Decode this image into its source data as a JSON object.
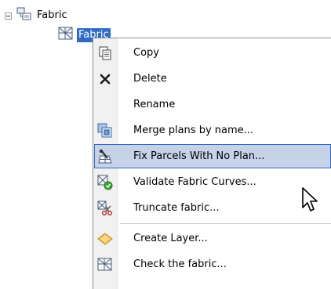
{
  "tree": {
    "root": {
      "label": "Fabric"
    },
    "child": {
      "label": "Fabric"
    }
  },
  "context_menu": {
    "items": [
      {
        "label": "Copy",
        "icon": "copy-icon"
      },
      {
        "label": "Delete",
        "icon": "delete-icon"
      },
      {
        "label": "Rename",
        "icon": ""
      },
      {
        "label": "Merge plans by name...",
        "icon": "merge-plans-icon"
      },
      {
        "label": "Fix Parcels With No Plan...",
        "icon": "fix-parcels-icon",
        "highlighted": true
      },
      {
        "label": "Validate Fabric Curves...",
        "icon": "validate-curves-icon"
      },
      {
        "label": "Truncate fabric...",
        "icon": "truncate-icon"
      },
      {
        "label": "Create Layer...",
        "icon": "create-layer-icon"
      },
      {
        "label": "Check the fabric...",
        "icon": "check-fabric-icon"
      }
    ]
  },
  "colors": {
    "selection": "#316ac5",
    "menu_highlight": "#c5d2e8"
  }
}
